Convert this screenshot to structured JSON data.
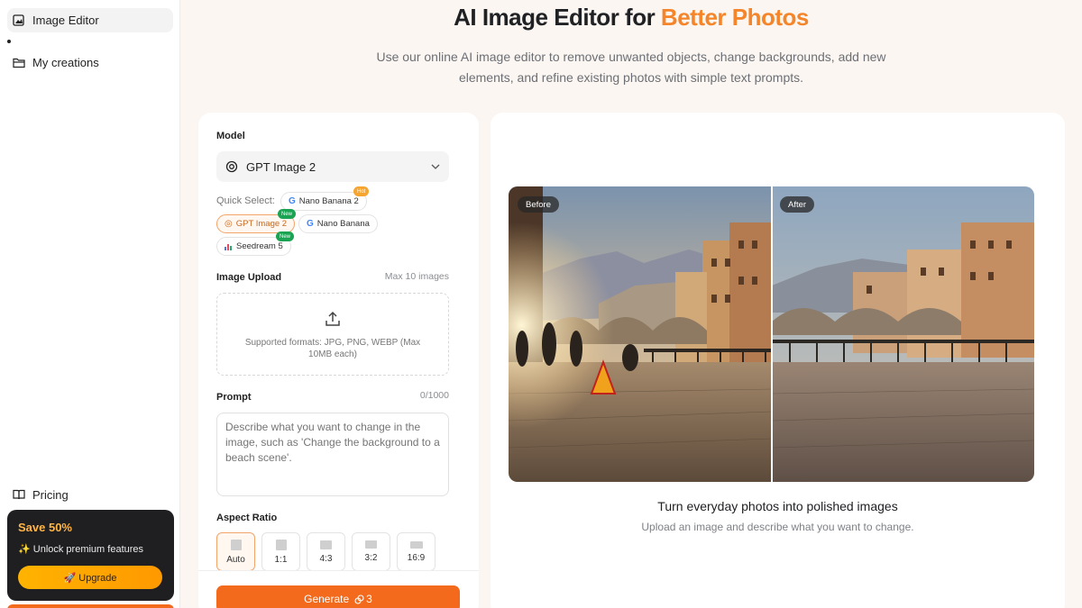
{
  "sidebar": {
    "items": [
      {
        "label": "Image Editor",
        "icon": "image-edit-icon"
      },
      {
        "label": "My creations",
        "icon": "folder-icon"
      }
    ],
    "pricing_label": "Pricing",
    "promo": {
      "save": "Save 50%",
      "unlock": "✨ Unlock premium features",
      "upgrade": "🚀 Upgrade"
    }
  },
  "header": {
    "title_main": "AI Image Editor for ",
    "title_accent": "Better Photos",
    "subtitle": "Use our online AI image editor to remove unwanted objects, change backgrounds, add new elements, and refine existing photos with simple text prompts."
  },
  "form": {
    "model_label": "Model",
    "model_selected": "GPT Image 2",
    "quick_select_label": "Quick Select:",
    "quick_chips": [
      {
        "label": "Nano Banana 2",
        "badge": "Hot"
      },
      {
        "label": "GPT Image 2",
        "badge": "New"
      },
      {
        "label": "Nano Banana",
        "badge": ""
      },
      {
        "label": "Seedream 5",
        "badge": "New"
      }
    ],
    "upload_label": "Image Upload",
    "upload_limit": "Max 10 images",
    "upload_formats": "Supported formats: JPG, PNG, WEBP (Max 10MB each)",
    "prompt_label": "Prompt",
    "prompt_count": "0/1000",
    "prompt_placeholder": "Describe what you want to change in the image, such as 'Change the background to a beach scene'.",
    "aspect_label": "Aspect Ratio",
    "aspect_options": [
      "Auto",
      "1:1",
      "4:3",
      "3:2",
      "16:9"
    ],
    "aspect_selected": "Auto",
    "generate_label": "Generate",
    "generate_cost": "3"
  },
  "preview": {
    "before_tag": "Before",
    "after_tag": "After",
    "caption": "Turn everyday photos into polished images",
    "caption_sub": "Upload an image and describe what you want to change."
  },
  "colors": {
    "accent": "#f5852a",
    "generate": "#f36a1d",
    "upgrade": "#ffb300"
  }
}
